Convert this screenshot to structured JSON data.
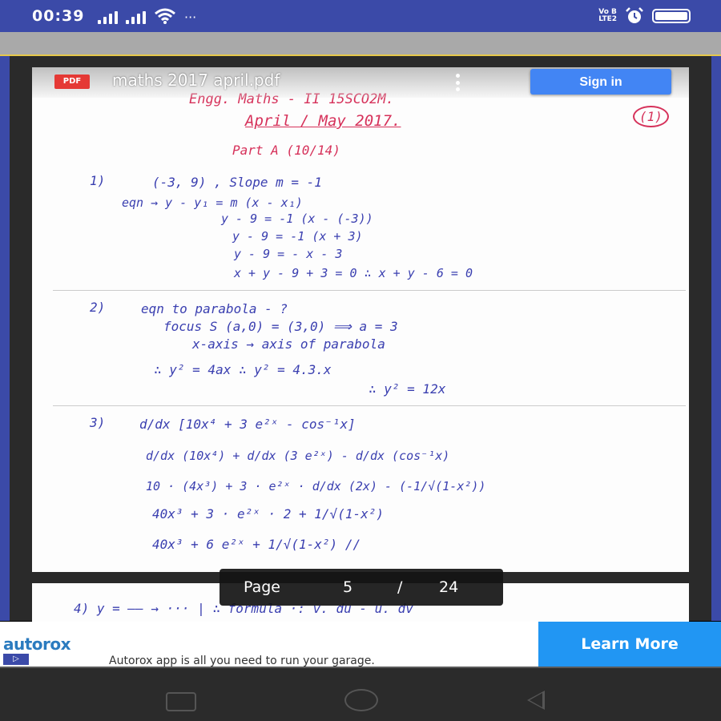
{
  "status_bar": {
    "time": "00:39",
    "dots": "···",
    "volte_top": "Vo B",
    "volte_bottom": "LTE2"
  },
  "viewer": {
    "pdf_badge": "PDF",
    "document_title": "maths 2017 april.pdf",
    "sign_in_label": "Sign in"
  },
  "page_content": {
    "header_line1": "Engg. Maths - II     15SCO2M.",
    "header_line2": "April / May 2017.",
    "page_mark": "(1)",
    "part_label": "Part A     (10/14)",
    "q1": {
      "num": "1)",
      "lines": [
        "(-3, 9) ,  Slope  m = -1",
        "eqn →  y - y₁ = m (x - x₁)",
        "y - 9 = -1 (x - (-3))",
        "y - 9 = -1 (x + 3)",
        "y - 9 = - x - 3",
        "x + y - 9 + 3 = 0      ∴ x + y - 6 = 0"
      ]
    },
    "q2": {
      "num": "2)",
      "lines": [
        "eqn to parabola - ?",
        "focus  S (a,0) = (3,0) ⟹ a = 3",
        "x-axis → axis of parabola",
        "∴ y² = 4ax       ∴ y² = 4.3.x",
        "∴ y² = 12x"
      ]
    },
    "q3": {
      "num": "3)",
      "lines": [
        "d/dx [10x⁴ + 3 e²ˣ - cos⁻¹x]",
        "d/dx (10x⁴)  +  d/dx (3 e²ˣ)  -  d/dx (cos⁻¹x)",
        "10 · (4x³)  + 3 · e²ˣ · d/dx (2x)  - (-1/√(1-x²))",
        "40x³ + 3 · e²ˣ · 2  +  1/√(1-x²)",
        "40x³ + 6 e²ˣ + 1/√(1-x²) //"
      ]
    },
    "q4_partial": "4)   y  =  ——  →  ···   | ∴ formula  ·: v. du - u. dv"
  },
  "page_indicator": {
    "label": "Page",
    "current": "5",
    "separator": "/",
    "total": "24"
  },
  "ad": {
    "brand": "autorox",
    "play_glyph": "▷",
    "tagline": "Autorox app is all you need to run your garage.",
    "cta": "Learn More"
  }
}
